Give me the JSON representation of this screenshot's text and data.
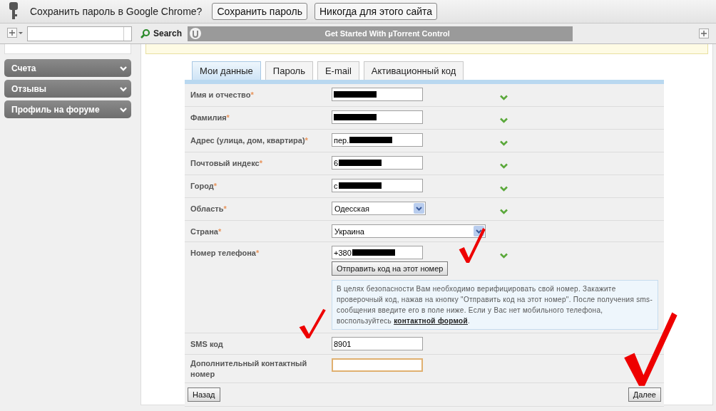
{
  "infobar": {
    "message": "Сохранить пароль в Google Chrome?",
    "buttons": [
      "Сохранить пароль",
      "Никогда для этого сайта"
    ]
  },
  "toolbar": {
    "search_label": "Search",
    "banner": "Get Started With µTorrent Control"
  },
  "sidebar": {
    "items": [
      {
        "label": "Счета",
        "expanded": false
      },
      {
        "label": "Отзывы",
        "expanded": false
      },
      {
        "label": "Профиль на форуме",
        "expanded": false
      }
    ]
  },
  "tabs": [
    {
      "label": "Мои данные",
      "selected": true
    },
    {
      "label": "Пароль",
      "selected": false
    },
    {
      "label": "E-mail",
      "selected": false
    },
    {
      "label": "Активационный код",
      "selected": false
    }
  ],
  "form": {
    "rows": [
      {
        "kind": "text",
        "label": "Имя и отчество",
        "required_mark": "*",
        "value": "",
        "redacted": true,
        "valid": true
      },
      {
        "kind": "text",
        "label": "Фамилия",
        "required_mark": "*",
        "value": "",
        "redacted": true,
        "valid": true
      },
      {
        "kind": "text",
        "label": "Адрес (улица, дом, квартира)",
        "required_mark": "*",
        "value": "пер.",
        "redacted": true,
        "valid": true
      },
      {
        "kind": "text",
        "label": "Почтовый индекс",
        "required_mark": "*",
        "value": "6",
        "redacted": true,
        "valid": true
      },
      {
        "kind": "text",
        "label": "Город",
        "required_mark": "*",
        "value": "с",
        "redacted": true,
        "valid": true
      },
      {
        "kind": "select",
        "label": "Область",
        "required_mark": "*",
        "value": "Одесская",
        "valid": true
      },
      {
        "kind": "wideselect",
        "label": "Страна",
        "required_mark": "*",
        "value": "Украина",
        "valid": false
      },
      {
        "kind": "phone",
        "label": "Номер телефона",
        "required_mark": "*",
        "value": "+380",
        "redacted": true,
        "valid": true,
        "send_button": "Отправить код на этот номер",
        "hint": "В целях безопасности Вам необходимо верифицировать свой номер. Закажите проверочный код, нажав на кнопку \"Отправить код на этот номер\". После получения sms-сообщения введите его в поле ниже. Если у Вас нет мобильного телефона, воспользуйтесь",
        "hint_link": "контактной формой",
        "hint_end": "."
      },
      {
        "kind": "text",
        "label": "SMS код",
        "value": "8901",
        "redacted": false,
        "valid": false,
        "focused": false
      },
      {
        "kind": "text",
        "label": "Дополнительный контактный номер",
        "value": "",
        "redacted": false,
        "valid": false,
        "focused": true
      }
    ],
    "back_button": "Назад",
    "next_button": "Далее"
  }
}
